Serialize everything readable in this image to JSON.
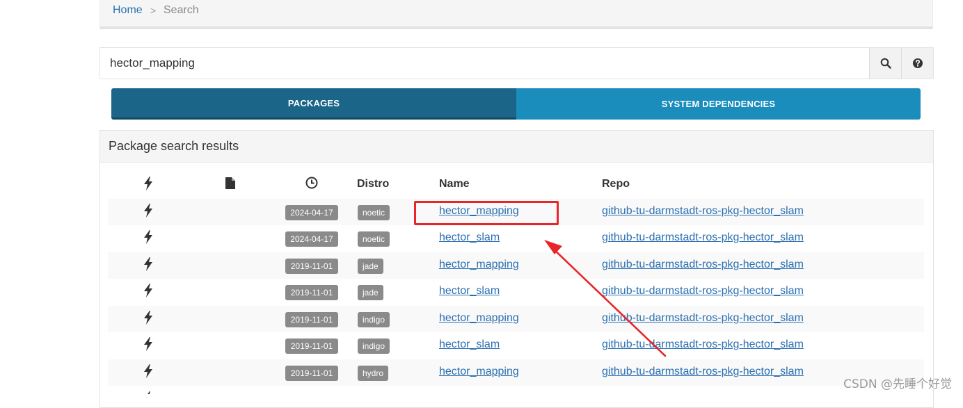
{
  "breadcrumb": {
    "home": "Home",
    "separator": ">",
    "current": "Search"
  },
  "search": {
    "value": "hector_mapping",
    "placeholder": ""
  },
  "tabs": [
    {
      "label": "PACKAGES",
      "active": true
    },
    {
      "label": "SYSTEM DEPENDENCIES",
      "active": false
    }
  ],
  "results": {
    "title": "Package search results",
    "columns": {
      "bolt": "bolt-icon",
      "file": "file-icon",
      "time": "clock-icon",
      "distro": "Distro",
      "name": "Name",
      "repo": "Repo"
    },
    "rows": [
      {
        "date": "2024-04-17",
        "distro": "noetic",
        "name": "hector_mapping",
        "repo": "github-tu-darmstadt-ros-pkg-hector_slam"
      },
      {
        "date": "2024-04-17",
        "distro": "noetic",
        "name": "hector_slam",
        "repo": "github-tu-darmstadt-ros-pkg-hector_slam"
      },
      {
        "date": "2019-11-01",
        "distro": "jade",
        "name": "hector_mapping",
        "repo": "github-tu-darmstadt-ros-pkg-hector_slam"
      },
      {
        "date": "2019-11-01",
        "distro": "jade",
        "name": "hector_slam",
        "repo": "github-tu-darmstadt-ros-pkg-hector_slam"
      },
      {
        "date": "2019-11-01",
        "distro": "indigo",
        "name": "hector_mapping",
        "repo": "github-tu-darmstadt-ros-pkg-hector_slam"
      },
      {
        "date": "2019-11-01",
        "distro": "indigo",
        "name": "hector_slam",
        "repo": "github-tu-darmstadt-ros-pkg-hector_slam"
      },
      {
        "date": "2019-11-01",
        "distro": "hydro",
        "name": "hector_mapping",
        "repo": "github-tu-darmstadt-ros-pkg-hector_slam"
      }
    ]
  },
  "colors": {
    "link": "#2a6fb1",
    "tab_active": "#1b6588",
    "tab_inactive": "#1b8dbd",
    "badge": "#8a8a8a",
    "annotation": "#e8262a"
  },
  "watermark": "CSDN @先睡个好觉"
}
